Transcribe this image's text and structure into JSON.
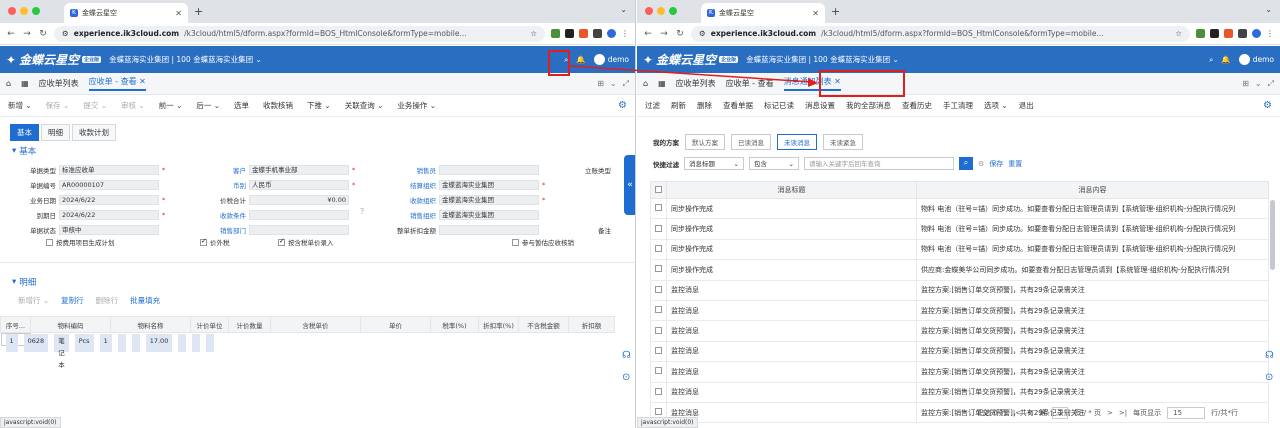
{
  "left": {
    "tab_title": "金蝶云星空",
    "url_host": "experience.ik3cloud.com",
    "url_path": "/k3cloud/html5/dform.aspx?formId=BOS_HtmlConsole&formType=mobile...",
    "logo": "金蝶云星空",
    "logo_badge": "企业版",
    "org": "金蝶蓝海实业集团 | 100 金蝶蓝海实业集团 ⌄",
    "user": "demo",
    "page_tabs": [
      "应收单列表",
      "应收单 - 查看"
    ],
    "toolbar": [
      "新增 ⌄",
      "保存 ⌄",
      "提交 ⌄",
      "审核 ⌄",
      "前一 ⌄",
      "后一 ⌄",
      "选单",
      "收款核销",
      "下推 ⌄",
      "关联查询 ⌄",
      "业务操作 ⌄"
    ],
    "subtabs": [
      "基本",
      "明细",
      "收款计划"
    ],
    "section_basic": "基本",
    "fields": {
      "doc_type_label": "单据类型",
      "doc_type": "标准应收单",
      "doc_no_label": "单据编号",
      "doc_no": "AR00000107",
      "biz_date_label": "业务日期",
      "biz_date": "2024/6/22",
      "due_date_label": "到期日",
      "due_date": "2024/6/22",
      "doc_status_label": "单据状态",
      "doc_status": "审核中",
      "by_order_label": "按费用项目生成计划",
      "customer_label": "客户",
      "customer": "金蝶手机事业部",
      "currency_label": "币别",
      "currency": "人民币",
      "price_total_label": "价税合计",
      "price_total": "¥0.00",
      "recv_cond_label": "收款条件",
      "sales_dept_label": "销售部门",
      "tax_incl_label": "价外税",
      "line_entry_label": "按含税单价录入",
      "salesman_label": "销售员",
      "settle_org_label": "结算组织",
      "settle_org": "金蝶蓝海实业集团",
      "recv_org_label": "收款组织",
      "recv_org": "金蝶蓝海实业集团",
      "sales_org_label": "销售组织",
      "sales_org": "金蝶蓝海实业集团",
      "discount_label": "整单折扣金额",
      "share_label": "参与暂估应收核销",
      "stand_type_label": "立账类型",
      "remark_label": "备注"
    },
    "section_detail": "明细",
    "detail_toolbar": [
      "新增行 ⌄",
      "复制行",
      "删除行",
      "批量填充"
    ],
    "detail_headers": [
      "序号...",
      "物料编码",
      "物料名称",
      "计价单位",
      "计价数量",
      "含税单价",
      "单价",
      "税率(%)",
      "折扣率(%)",
      "不含税金额",
      "折扣额"
    ],
    "detail_rows": [
      [
        "1",
        "0628",
        "笔记本",
        "Pcs",
        "1",
        "",
        "",
        "17.00",
        "",
        "",
        ""
      ]
    ],
    "status": "javascript:void(0)"
  },
  "right": {
    "tab_title": "金蝶云星空",
    "url_host": "experience.ik3cloud.com",
    "url_path": "/k3cloud/html5/dform.aspx?formId=BOS_HtmlConsole&formType=mobile...",
    "logo": "金蝶云星空",
    "logo_badge": "企业版",
    "org": "金蝶蓝海实业集团 | 100 金蝶蓝海实业集团 ⌄",
    "user": "demo",
    "page_tabs": [
      "应收单列表",
      "应收单 - 查看",
      "消息通知列表"
    ],
    "toolbar": [
      "过滤",
      "刷新",
      "删除",
      "查看单据",
      "标记已读",
      "消息设置",
      "我的全部消息",
      "查看历史",
      "手工清理",
      "选项 ⌄",
      "退出"
    ],
    "scheme_label": "我的方案",
    "schemes": [
      "默认方案",
      "已读消息",
      "未读消息",
      "未读紧急"
    ],
    "quick_label": "快捷过滤",
    "filter_field": "消息标题",
    "filter_op": "包含",
    "keyword_placeholder": "请输入关键字后回车查询",
    "save_label": "保存",
    "reset_label": "重置",
    "headers": [
      "消息标题",
      "消息内容"
    ],
    "rows": [
      [
        "同步操作完成",
        "物料 电池（驻号=锚）同步成功。如要查看分配日志管理员请到【系统管理-组织机构-分配执行情况列"
      ],
      [
        "同步操作完成",
        "物料 电池（驻号=锚）同步成功。如要查看分配日志管理员请到【系统管理-组织机构-分配执行情况列"
      ],
      [
        "同步操作完成",
        "物料 电池（驻号=锚）同步成功。如要查看分配日志管理员请到【系统管理-组织机构-分配执行情况列"
      ],
      [
        "同步操作完成",
        "供应商:金蝶美华公司同步成功。如要查看分配日志管理员请到【系统管理-组织机构-分配执行情况列"
      ],
      [
        "监控消息",
        "监控方案:[销售订单交货预警]，共有29条记录需关注"
      ],
      [
        "监控消息",
        "监控方案:[销售订单交货预警]，共有29条记录需关注"
      ],
      [
        "监控消息",
        "监控方案:[销售订单交货预警]，共有29条记录需关注"
      ],
      [
        "监控消息",
        "监控方案:[销售订单交货预警]，共有29条记录需关注"
      ],
      [
        "监控消息",
        "监控方案:[销售订单交货预警]，共有29条记录需关注"
      ],
      [
        "监控消息",
        "监控方案:[销售订单交货预警]，共有29条记录需关注"
      ],
      [
        "监控消息",
        "监控方案:[销售订单交货预警]，共有29条记录需关注"
      ]
    ],
    "pager": {
      "selected": "已选 0 行",
      "page_prefix": "第",
      "page": "1",
      "page_suffix": "页 / * 页",
      "per_page_label": "每页显示",
      "per_page": "15",
      "total": "行/共*行"
    },
    "status": "javascript:void(0)"
  },
  "colors": {
    "primary": "#1f6dd1",
    "appbar": "#2a6ec2",
    "highlight": "#e01e1e"
  }
}
